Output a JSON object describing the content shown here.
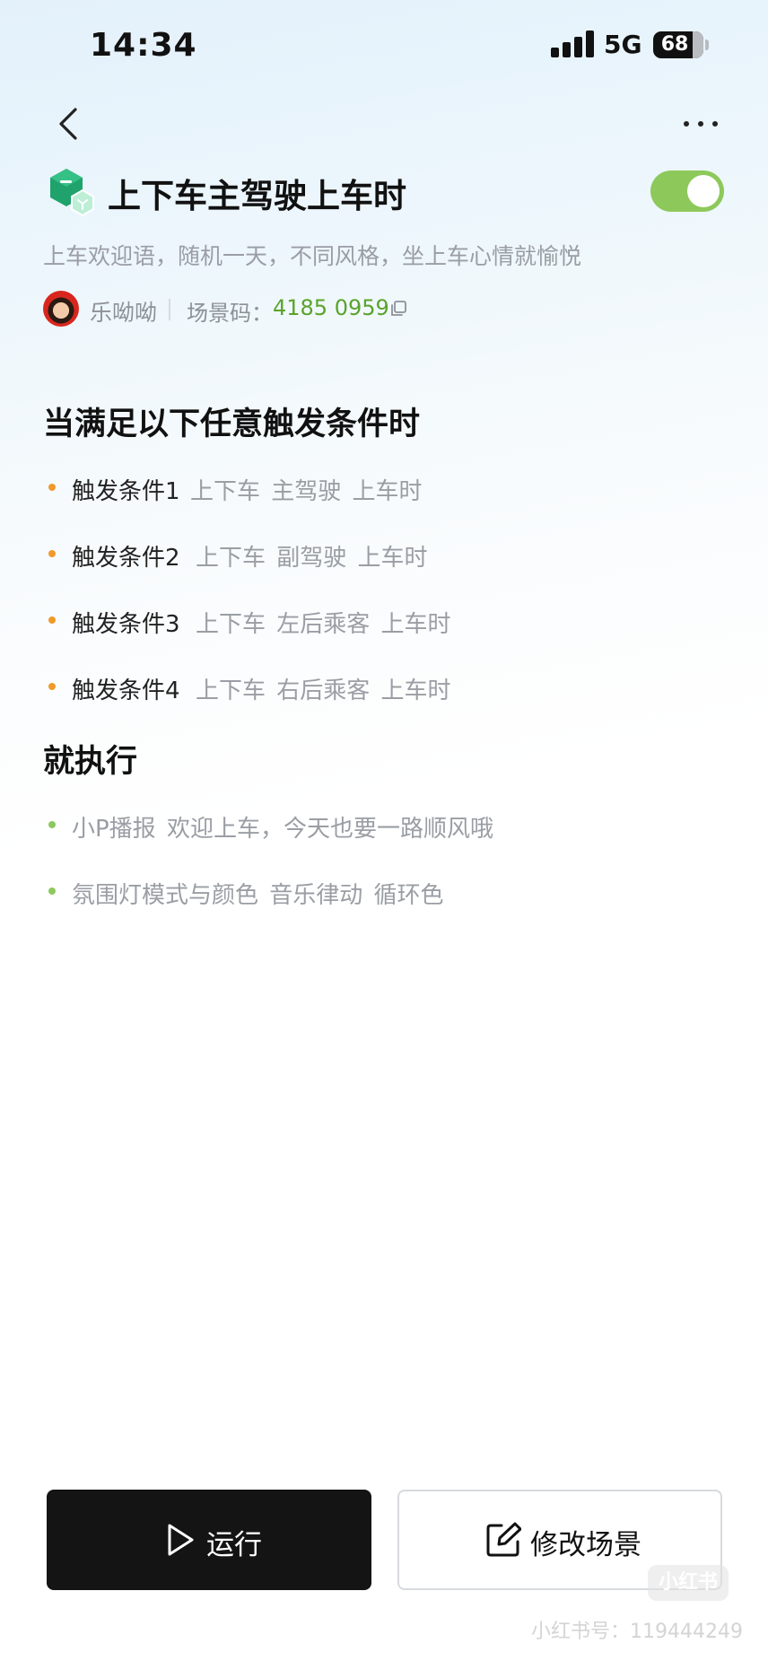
{
  "status_bar": {
    "time": "14:34",
    "network": "5G",
    "battery": "68"
  },
  "scene": {
    "title": "上下车主驾驶上车时",
    "description": "上车欢迎语，随机一天，不同风格，坐上车心情就愉悦",
    "enabled": true,
    "author": "乐呦呦",
    "code_label": "场景码：",
    "code_value": "4185 0959"
  },
  "triggers_section": {
    "title": "当满足以下任意触发条件时",
    "items": [
      {
        "label": "触发条件1",
        "detail": "上下车 主驾驶 上车时"
      },
      {
        "label": "触发条件2",
        "detail": "上下车 副驾驶 上车时"
      },
      {
        "label": "触发条件3",
        "detail": "上下车 左后乘客 上车时"
      },
      {
        "label": "触发条件4",
        "detail": "上下车 右后乘客 上车时"
      }
    ]
  },
  "actions_section": {
    "title": "就执行",
    "items": [
      {
        "text": "小P播报 欢迎上车，今天也要一路顺风哦"
      },
      {
        "text": "氛围灯模式与颜色 音乐律动 循环色"
      }
    ]
  },
  "buttons": {
    "run_label": "运行",
    "edit_label": "修改场景"
  },
  "watermark": {
    "logo": "小红书",
    "text": "小红书号：119444249"
  },
  "colors": {
    "accent_green": "#8dc95a",
    "code_green": "#5aa32a",
    "trigger_dot": "#ef9a2b",
    "action_dot": "#8cc95e",
    "run_button": "#141414"
  }
}
